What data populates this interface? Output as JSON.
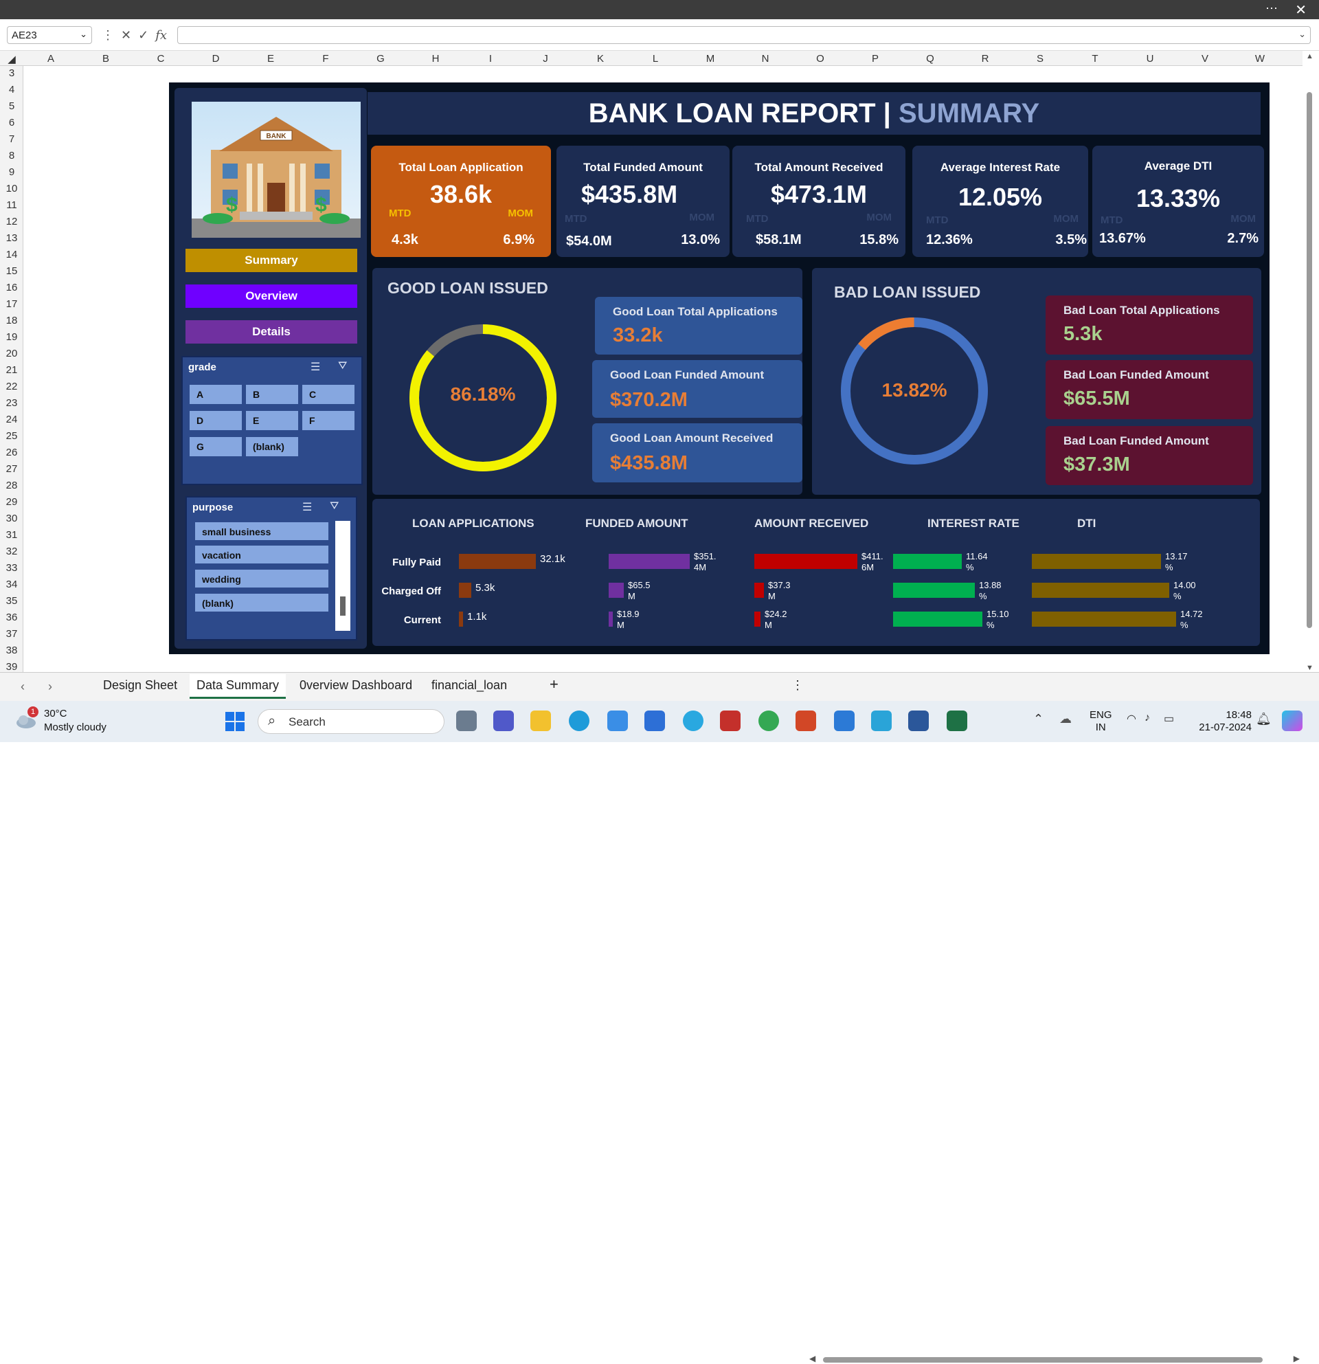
{
  "formula_bar": {
    "name_box": "AE23",
    "fx": "fx"
  },
  "columns": [
    "A",
    "B",
    "C",
    "D",
    "E",
    "F",
    "G",
    "H",
    "I",
    "J",
    "K",
    "L",
    "M",
    "N",
    "O",
    "P",
    "Q",
    "R",
    "S",
    "T",
    "U",
    "V",
    "W"
  ],
  "rows": [
    "3",
    "4",
    "5",
    "6",
    "7",
    "8",
    "9",
    "10",
    "11",
    "12",
    "13",
    "14",
    "15",
    "16",
    "17",
    "18",
    "19",
    "20",
    "21",
    "22",
    "23",
    "24",
    "25",
    "26",
    "27",
    "28",
    "29",
    "30",
    "31",
    "32",
    "33",
    "34",
    "35",
    "36",
    "37",
    "38",
    "39"
  ],
  "dashboard": {
    "title_main": "BANK LOAN REPORT | ",
    "title_accent": "SUMMARY",
    "nav": {
      "summary": "Summary",
      "overview": "Overview",
      "details": "Details"
    },
    "grade_slicer": {
      "title": "grade",
      "items": [
        "A",
        "B",
        "C",
        "D",
        "E",
        "F",
        "G",
        "(blank)"
      ]
    },
    "purpose_slicer": {
      "title": "purpose",
      "items": [
        "small business",
        "vacation",
        "wedding",
        "(blank)"
      ]
    },
    "kpis": [
      {
        "label": "Total Loan Application",
        "value": "38.6k",
        "mtd_label": "MTD",
        "mom_label": "MOM",
        "mtd": "4.3k",
        "mom": "6.9%"
      },
      {
        "label": "Total Funded Amount",
        "value": "$435.8M",
        "mtd_label": "MTD",
        "mom_label": "MOM",
        "mtd": "$54.0M",
        "mom": "13.0%"
      },
      {
        "label": "Total Amount Received",
        "value": "$473.1M",
        "mtd_label": "MTD",
        "mom_label": "MOM",
        "mtd": "$58.1M",
        "mom": "15.8%"
      },
      {
        "label": "Average Interest Rate",
        "value": "12.05%",
        "mtd_label": "MTD",
        "mom_label": "MOM",
        "mtd": "12.36%",
        "mom": "3.5%"
      },
      {
        "label": "Average DTI",
        "value": "13.33%",
        "mtd_label": "MTD",
        "mom_label": "MOM",
        "mtd": "13.67%",
        "mom": "2.7%"
      }
    ],
    "good": {
      "title": "GOOD LOAN ISSUED",
      "pct": "86.18%",
      "pct_value": 86.18,
      "cards": [
        {
          "label": "Good Loan Total Applications",
          "value": "33.2k"
        },
        {
          "label": "Good Loan Funded Amount",
          "value": "$370.2M"
        },
        {
          "label": "Good Loan Amount Received",
          "value": "$435.8M"
        }
      ]
    },
    "bad": {
      "title": "BAD LOAN ISSUED",
      "pct": "13.82%",
      "pct_value": 13.82,
      "cards": [
        {
          "label": "Bad Loan Total Applications",
          "value": "5.3k"
        },
        {
          "label": "Bad Loan Funded Amount",
          "value": "$65.5M"
        },
        {
          "label": "Bad Loan Funded Amount",
          "value": "$37.3M"
        }
      ]
    },
    "status_labels": [
      "Fully Paid",
      "Charged Off",
      "Current"
    ]
  },
  "chart_data": [
    {
      "type": "bar",
      "title": "LOAN APPLICATIONS",
      "categories": [
        "Fully Paid",
        "Charged Off",
        "Current"
      ],
      "values": [
        32.1,
        5.3,
        1.1
      ],
      "labels": [
        "32.1k",
        "5.3k",
        "1.1k"
      ],
      "color": "#8b3a0f"
    },
    {
      "type": "bar",
      "title": "FUNDED AMOUNT",
      "categories": [
        "Fully Paid",
        "Charged Off",
        "Current"
      ],
      "values": [
        351.4,
        65.5,
        18.9
      ],
      "labels": [
        "$351.\n4M",
        "$65.5\nM",
        "$18.9\nM"
      ],
      "color": "#7030a0"
    },
    {
      "type": "bar",
      "title": "AMOUNT RECEIVED",
      "categories": [
        "Fully Paid",
        "Charged Off",
        "Current"
      ],
      "values": [
        411.6,
        37.3,
        24.2
      ],
      "labels": [
        "$411.\n6M",
        "$37.3\nM",
        "$24.2\nM"
      ],
      "color": "#c00000"
    },
    {
      "type": "bar",
      "title": "INTEREST RATE",
      "categories": [
        "Fully Paid",
        "Charged Off",
        "Current"
      ],
      "values": [
        11.64,
        13.88,
        15.1
      ],
      "labels": [
        "11.64\n%",
        "13.88\n%",
        "15.10\n%"
      ],
      "color": "#00b050"
    },
    {
      "type": "bar",
      "title": "DTI",
      "categories": [
        "Fully Paid",
        "Charged Off",
        "Current"
      ],
      "values": [
        13.17,
        14.0,
        14.72
      ],
      "labels": [
        "13.17\n%",
        "14.00\n%",
        "14.72\n%"
      ],
      "color": "#7f6000"
    }
  ],
  "sheet_tabs": [
    "Design Sheet",
    "Data Summary",
    "0verview Dashboard",
    "financial_loan"
  ],
  "taskbar": {
    "temp": "30°C",
    "weather": "Mostly cloudy",
    "notif": "1",
    "search": "Search",
    "lang1": "ENG",
    "lang2": "IN",
    "time": "18:48",
    "date": "21-07-2024"
  }
}
